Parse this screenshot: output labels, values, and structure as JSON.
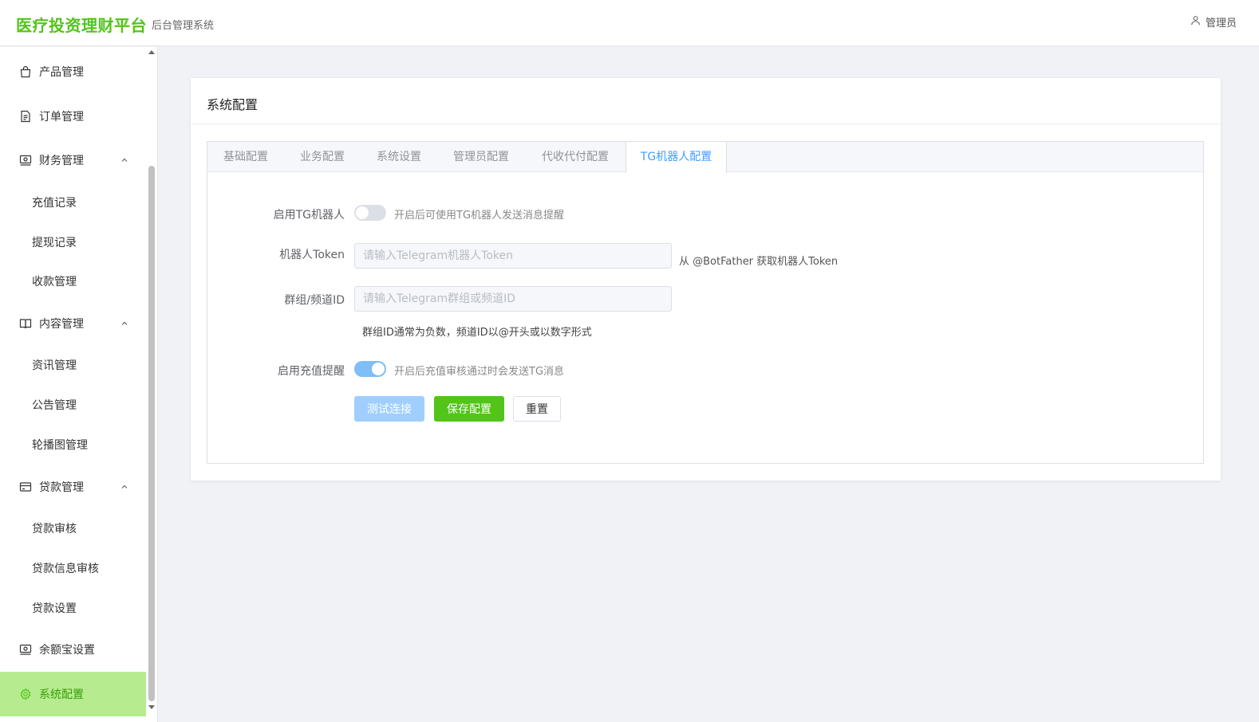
{
  "header": {
    "brand": "医疗投资理财平台",
    "subtitle": "后台管理系统",
    "user": "管理员"
  },
  "sidebar": {
    "items": [
      {
        "label": "产品管理",
        "icon": "bag-icon"
      },
      {
        "label": "订单管理",
        "icon": "document-icon"
      },
      {
        "label": "财务管理",
        "icon": "finance-icon",
        "expanded": true
      },
      {
        "label": "充值记录"
      },
      {
        "label": "提现记录"
      },
      {
        "label": "收款管理"
      },
      {
        "label": "内容管理",
        "icon": "book-icon",
        "expanded": true
      },
      {
        "label": "资讯管理"
      },
      {
        "label": "公告管理"
      },
      {
        "label": "轮播图管理"
      },
      {
        "label": "贷款管理",
        "icon": "card-icon",
        "expanded": true
      },
      {
        "label": "贷款审核"
      },
      {
        "label": "贷款信息审核"
      },
      {
        "label": "贷款设置"
      },
      {
        "label": "余额宝设置",
        "icon": "finance-icon"
      },
      {
        "label": "系统配置",
        "icon": "gear-icon",
        "active": true
      }
    ]
  },
  "card": {
    "title": "系统配置",
    "tabs": [
      "基础配置",
      "业务配置",
      "系统设置",
      "管理员配置",
      "代收代付配置",
      "TG机器人配置"
    ],
    "active_tab": "TG机器人配置"
  },
  "form": {
    "enable_tg_label": "启用TG机器人",
    "enable_tg_hint": "开启后可使用TG机器人发送消息提醒",
    "enable_tg": false,
    "token_label": "机器人Token",
    "token_placeholder": "请输入Telegram机器人Token",
    "token_hint": "从 @BotFather 获取机器人Token",
    "chat_label": "群组/频道ID",
    "chat_placeholder": "请输入Telegram群组或频道ID",
    "chat_note": "群组ID通常为负数，频道ID以@开头或以数字形式",
    "recharge_label": "启用充值提醒",
    "recharge_hint": "开启后充值审核通过时会发送TG消息",
    "enable_recharge": true,
    "btn_test": "测试连接",
    "btn_save": "保存配置",
    "btn_reset": "重置"
  },
  "colors": {
    "brand": "#52c41a",
    "active_menu_bg": "#b7eb8f",
    "active_tab": "#409eff"
  }
}
